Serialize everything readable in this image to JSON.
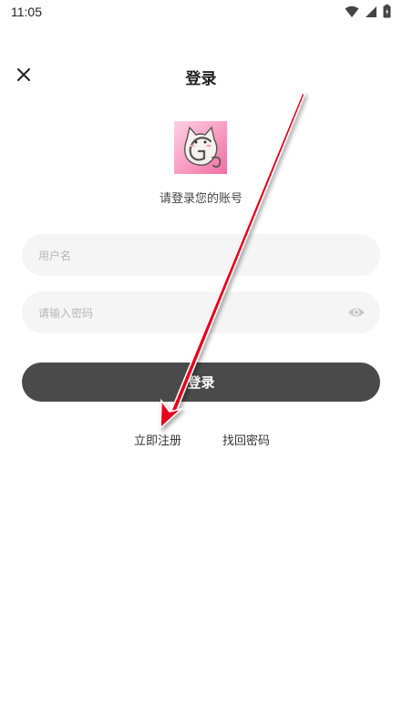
{
  "status_bar": {
    "time": "11:05"
  },
  "header": {
    "title": "登录",
    "close_icon": "close-icon"
  },
  "logo": {
    "icon": "cat-g-logo"
  },
  "subtitle": "请登录您的账号",
  "form": {
    "username": {
      "value": "",
      "placeholder": "用户名"
    },
    "password": {
      "value": "",
      "placeholder": "请输入密码",
      "toggle_icon": "eye-icon"
    },
    "login_label": "登录"
  },
  "links": {
    "register": "立即注册",
    "forgot": "找回密码"
  },
  "colors": {
    "button": "#4a4a4a",
    "field_bg": "#f5f5f5",
    "arrow": "#e8001c"
  }
}
